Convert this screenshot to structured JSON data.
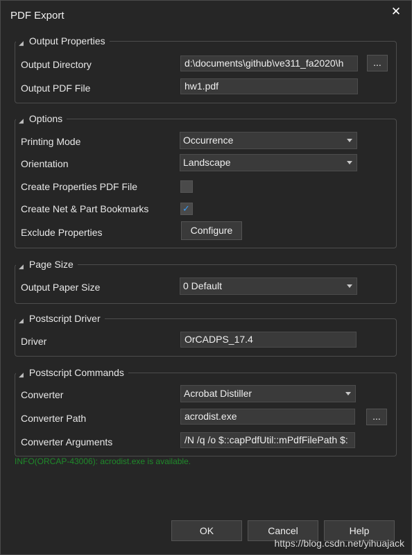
{
  "dialog": {
    "title": "PDF Export",
    "close_glyph": "✕"
  },
  "output_properties": {
    "title": "Output Properties",
    "directory_label": "Output Directory",
    "directory_value": "d:\\documents\\github\\ve311_fa2020\\h",
    "browse_label": "...",
    "file_label": "Output PDF File",
    "file_value": "hw1.pdf"
  },
  "options": {
    "title": "Options",
    "printing_mode_label": "Printing Mode",
    "printing_mode_value": "Occurrence",
    "orientation_label": "Orientation",
    "orientation_value": "Landscape",
    "create_props_label": "Create Properties PDF File",
    "create_props_checked": false,
    "create_bookmarks_label": "Create Net & Part Bookmarks",
    "create_bookmarks_checked": true,
    "checkmark_glyph": "✓",
    "exclude_label": "Exclude Properties",
    "configure_label": "Configure"
  },
  "page_size": {
    "title": "Page Size",
    "paper_size_label": "Output Paper Size",
    "paper_size_value": "0 Default"
  },
  "postscript_driver": {
    "title": "Postscript Driver",
    "driver_label": "Driver",
    "driver_value": "OrCADPS_17.4"
  },
  "postscript_commands": {
    "title": "Postscript Commands",
    "converter_label": "Converter",
    "converter_value": "Acrobat Distiller",
    "converter_path_label": "Converter Path",
    "converter_path_value": "acrodist.exe",
    "browse_label": "...",
    "converter_args_label": "Converter Arguments",
    "converter_args_value": "/N /q /o $::capPdfUtil::mPdfFilePath $:"
  },
  "info_message": "INFO(ORCAP-43006): acrodist.exe is available.",
  "buttons": {
    "ok": "OK",
    "cancel": "Cancel",
    "help": "Help"
  },
  "watermark": "https://blog.csdn.net/yihuajack",
  "colors": {
    "background": "#262626",
    "field": "#3a3a3a",
    "info_text": "#1f8a2a",
    "checkmark": "#3a9bf5"
  }
}
